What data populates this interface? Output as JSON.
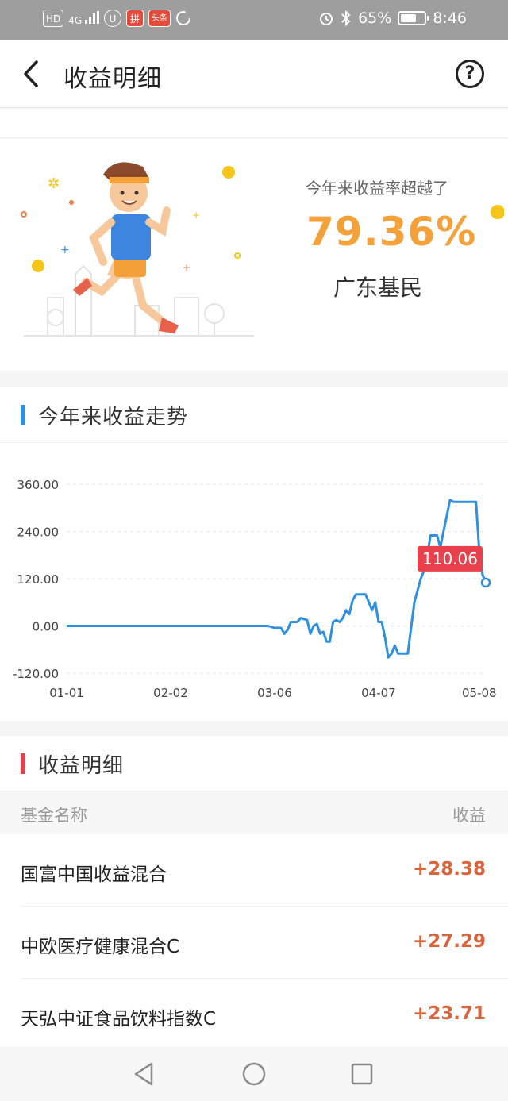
{
  "status_bar": {
    "left_icons": [
      "HD",
      "4G",
      "U",
      "拼",
      "头条"
    ],
    "battery_text": "65%",
    "battery_level": 0.65,
    "time": "8:46",
    "icons": [
      "hd-icon",
      "signal-icon",
      "app-icon",
      "pinduoduo-icon",
      "toutiao-icon",
      "loading-icon",
      "alarm-icon",
      "bluetooth-icon",
      "battery-icon"
    ]
  },
  "header": {
    "title": "收益明细",
    "back_icon": "chevron-left-icon",
    "help_icon": "question-circle-icon",
    "help_glyph": "?"
  },
  "rank": {
    "label": "今年来收益率超越了",
    "percent": "79.36%",
    "region": "广东基民",
    "accent_color": "#f4a13a"
  },
  "trend": {
    "title": "今年来收益走势",
    "bar_color": "#2f8fe0",
    "line_color": "#2f8fe0",
    "tooltip_color": "#e8414b"
  },
  "chart_data": {
    "type": "line",
    "ylim": [
      -120,
      360
    ],
    "yticks": [
      "360.00",
      "240.00",
      "120.00",
      "0.00",
      "-120.00"
    ],
    "ytick_values": [
      360,
      240,
      120,
      0,
      -120
    ],
    "xticks": [
      "01-01",
      "02-02",
      "03-06",
      "04-07",
      "05-08"
    ],
    "xtick_days": [
      0,
      32,
      64,
      96,
      127
    ],
    "x_domain": [
      0,
      129
    ],
    "grid": true,
    "tooltip": "110.06",
    "series": [
      {
        "x": [
          0,
          10,
          20,
          30,
          40,
          50,
          60,
          62,
          64,
          65,
          66,
          67,
          68,
          69,
          70,
          71,
          72,
          74,
          75,
          76,
          77,
          78,
          79,
          80,
          81,
          82,
          83,
          84,
          85,
          86,
          87,
          88,
          89,
          90,
          91,
          92,
          93,
          94,
          95,
          96,
          97,
          98,
          99,
          100,
          101,
          102,
          103,
          104,
          105,
          107,
          108,
          109,
          110,
          111,
          112,
          113,
          114,
          115,
          116,
          117,
          118,
          119,
          120,
          121,
          122,
          123,
          124,
          125,
          126,
          127,
          128,
          129
        ],
        "y": [
          0,
          0,
          0,
          0,
          0,
          0,
          0,
          0,
          -5,
          -5,
          -5,
          -20,
          -10,
          10,
          10,
          10,
          20,
          15,
          -20,
          0,
          5,
          -20,
          -15,
          -40,
          -40,
          10,
          15,
          10,
          20,
          40,
          30,
          65,
          80,
          80,
          80,
          80,
          60,
          40,
          60,
          10,
          10,
          -30,
          -80,
          -70,
          -50,
          -70,
          -70,
          -70,
          -70,
          60,
          90,
          120,
          140,
          180,
          230,
          230,
          230,
          200,
          240,
          280,
          320,
          315,
          315,
          315,
          315,
          315,
          315,
          315,
          315,
          190,
          130,
          110.06
        ]
      }
    ]
  },
  "income": {
    "title": "收益明细",
    "bar_color": "#e8414b",
    "col_name": "基金名称",
    "col_amount": "收益",
    "rows": [
      {
        "name": "国富中国收益混合",
        "amount": "+28.38"
      },
      {
        "name": "中欧医疗健康混合C",
        "amount": "+27.29"
      },
      {
        "name": "天弘中证食品饮料指数C",
        "amount": "+23.71"
      }
    ]
  },
  "navbar": {
    "icons": [
      "nav-back-icon",
      "nav-home-icon",
      "nav-recents-icon"
    ]
  }
}
